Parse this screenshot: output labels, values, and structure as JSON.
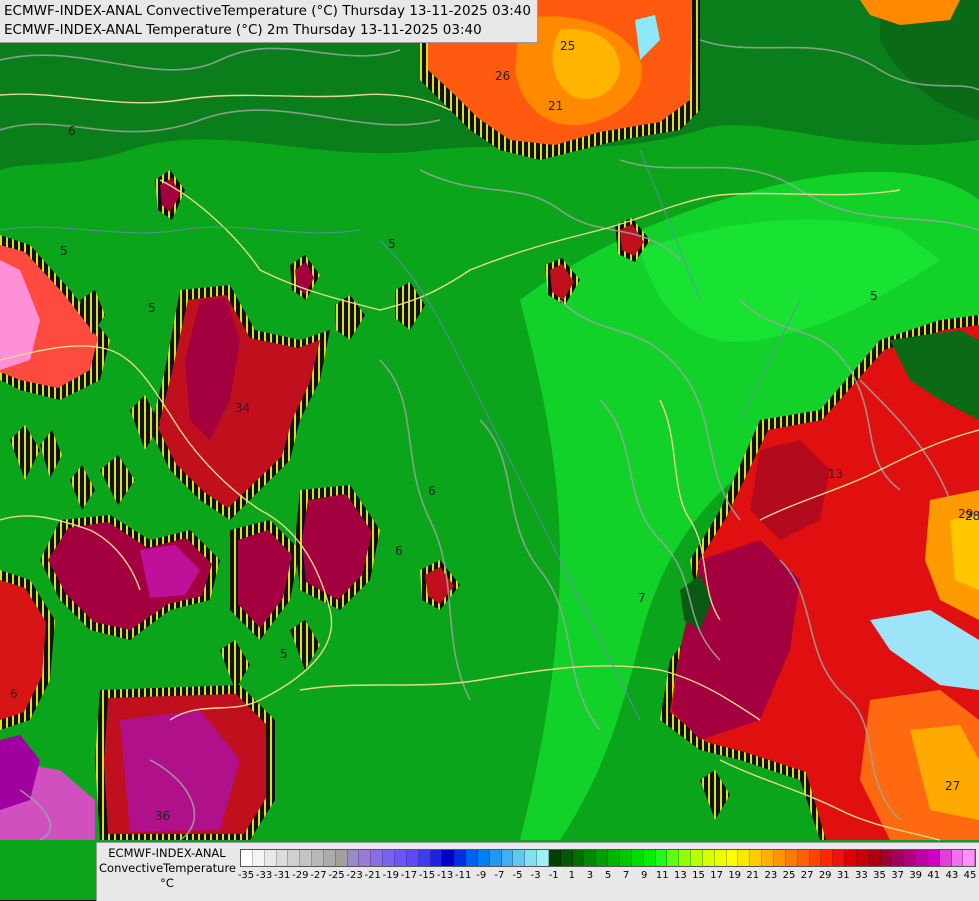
{
  "header": {
    "line1": "ECMWF-INDEX-ANAL ConvectiveTemperature (°C) Thursday 13-11-2025 03:40",
    "line2": "ECMWF-INDEX-ANAL Temperature (°C) 2m Thursday 13-11-2025 03:40"
  },
  "legend": {
    "line1": "ECMWF-INDEX-ANAL",
    "line2": "ConvectiveTemperature",
    "line3": "°C",
    "ticks": [
      "-35",
      "-33",
      "-31",
      "-29",
      "-27",
      "-25",
      "-23",
      "-21",
      "-19",
      "-17",
      "-15",
      "-13",
      "-11",
      "-9",
      "-7",
      "-5",
      "-3",
      "-1",
      "1",
      "3",
      "5",
      "7",
      "9",
      "11",
      "13",
      "15",
      "17",
      "19",
      "21",
      "23",
      "25",
      "27",
      "29",
      "31",
      "33",
      "35",
      "37",
      "39",
      "41",
      "43",
      "45"
    ],
    "colors": [
      "#ffffff",
      "#f4f4f4",
      "#e8e8e8",
      "#dcdcdc",
      "#d0d0d0",
      "#c4c4c4",
      "#b8b8b8",
      "#acacac",
      "#a0a0a0",
      "#9a88c8",
      "#9a7ad8",
      "#8a6ee8",
      "#7a62f0",
      "#6a56f8",
      "#5a4af8",
      "#3c3cf0",
      "#2020e0",
      "#0000c8",
      "#0030e0",
      "#0060f0",
      "#0080f0",
      "#2098f0",
      "#40b0f0",
      "#60c8f0",
      "#80e0f0",
      "#a0f0f0",
      "#004000",
      "#005800",
      "#006e00",
      "#008800",
      "#009e00",
      "#00b400",
      "#00c800",
      "#00dc00",
      "#00f000",
      "#20f820",
      "#60ff10",
      "#90ff00",
      "#b8ff00",
      "#d8ff00",
      "#f0ff00",
      "#ffff00",
      "#ffe600",
      "#ffcc00",
      "#ffb000",
      "#ff9600",
      "#ff7c00",
      "#ff6000",
      "#ff4400",
      "#ff2800",
      "#f01010",
      "#e00000",
      "#c80000",
      "#b00010",
      "#a00030",
      "#a00060",
      "#b00080",
      "#c000a0",
      "#d000c0",
      "#e040d8",
      "#f070f0",
      "#ff90ff"
    ]
  },
  "map_labels": [
    "34",
    "36",
    "28",
    "25",
    "26",
    "21",
    "27",
    "6",
    "5",
    "5",
    "5",
    "6",
    "6",
    "5",
    "7",
    "13",
    "29",
    "5",
    "6"
  ]
}
